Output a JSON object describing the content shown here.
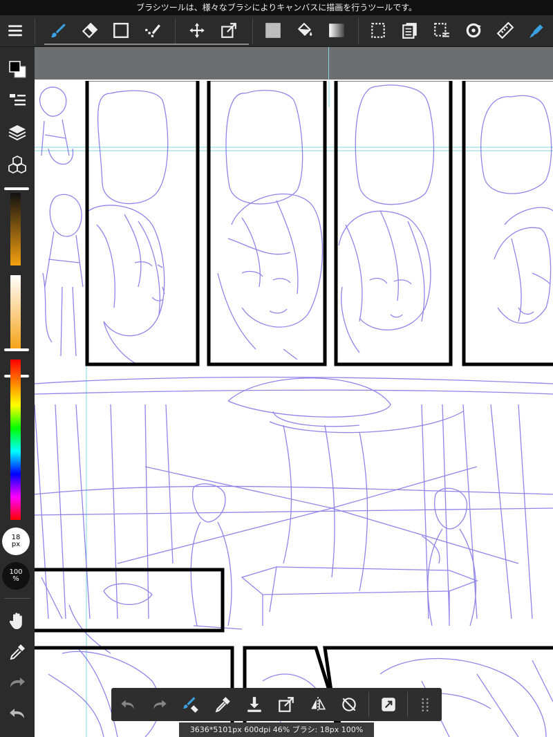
{
  "hint_bar": {
    "text": "ブラシツールは、様々なブラシによりキャンバスに描画を行うツールです。"
  },
  "toolbar": {
    "tools": [
      {
        "name": "brush-tool",
        "active": true
      },
      {
        "name": "eraser-tool",
        "active": false
      },
      {
        "name": "shape-tool",
        "active": false
      },
      {
        "name": "select-check-tool",
        "active": false
      },
      {
        "name": "move-tool",
        "active": false
      },
      {
        "name": "transform-tool",
        "active": false
      },
      {
        "name": "fill-color-tool",
        "active": false
      },
      {
        "name": "bucket-tool",
        "active": false
      },
      {
        "name": "gradation-tool",
        "active": false
      },
      {
        "name": "select-tool",
        "active": false
      },
      {
        "name": "copy-paste-tool",
        "active": false
      },
      {
        "name": "select-pen-tool",
        "active": false
      },
      {
        "name": "rotate-tool",
        "active": false
      },
      {
        "name": "ruler-tool",
        "active": false
      },
      {
        "name": "snap-tool",
        "active": true
      }
    ],
    "accent_color": "#3aa0e0"
  },
  "sidebar": {
    "brush_size_badge": {
      "value": "18",
      "unit": "px"
    },
    "opacity_badge": {
      "value": "100",
      "unit": "%"
    }
  },
  "status": {
    "text": "3636*5101px 600dpi 46% ブラシ: 18px 100%"
  },
  "colors": {
    "sketch": "#7b6fe8",
    "panel_border": "#000000",
    "guide": "#7fd4e0",
    "toolbar_bg": "#2b2b2b",
    "ruler_strip": "#6c6e72"
  }
}
